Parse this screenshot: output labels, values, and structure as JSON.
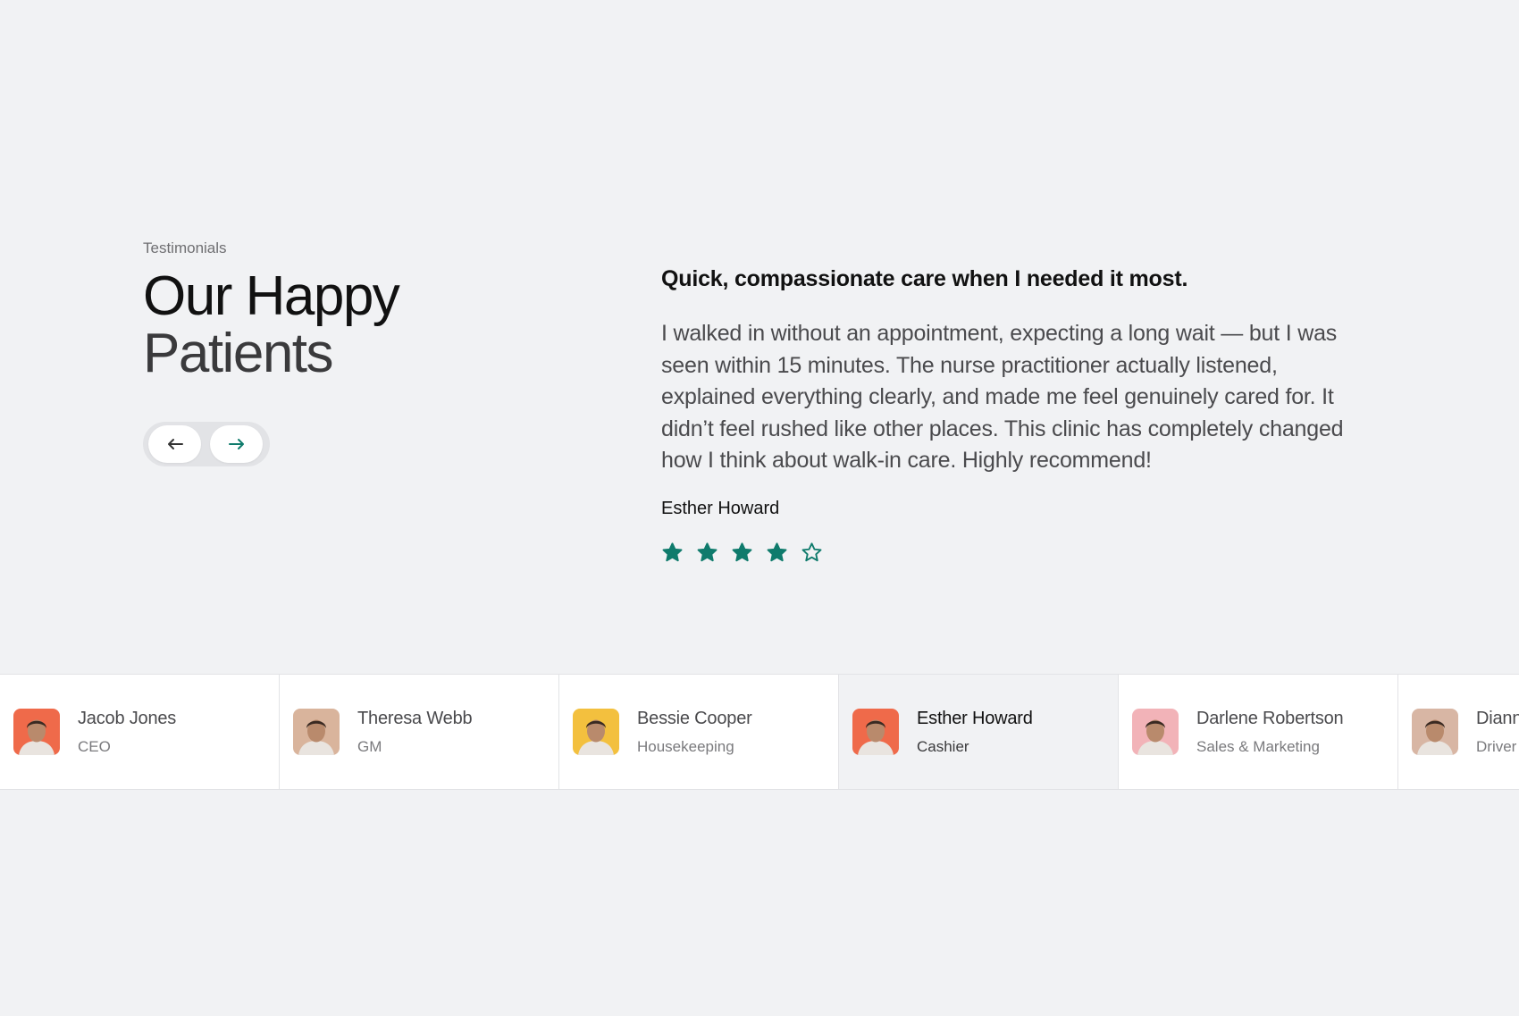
{
  "section": {
    "label": "Testimonials",
    "title_line1": "Our Happy",
    "title_line2": "Patients"
  },
  "nav": {
    "prev_icon": "arrow-left-icon",
    "next_icon": "arrow-right-icon"
  },
  "testimonial": {
    "headline": "Quick, compassionate care when I needed it most.",
    "body": "I walked in without an appointment, expecting a long wait — but I was seen within 15 minutes. The nurse practitioner actually listened, explained everything clearly, and made me feel genuinely cared for. It didn’t feel rushed like other places. This clinic has completely changed how I think about walk-in care. Highly recommend!",
    "author": "Esther Howard",
    "rating": 4,
    "rating_max": 5
  },
  "colors": {
    "accent": "#0f7b6c",
    "background": "#f1f2f4",
    "card_background": "#ffffff",
    "active_card_background": "#f1f2f4"
  },
  "team": [
    {
      "name": "Jacob Jones",
      "role": "CEO",
      "avatar_bg": "#ef6a4a",
      "active": false
    },
    {
      "name": "Theresa Webb",
      "role": "GM",
      "avatar_bg": "#d9b49c",
      "active": false
    },
    {
      "name": "Bessie Cooper",
      "role": "Housekeeping",
      "avatar_bg": "#f3c03e",
      "active": false
    },
    {
      "name": "Esther Howard",
      "role": "Cashier",
      "avatar_bg": "#ef6a4a",
      "active": true
    },
    {
      "name": "Darlene Robertson",
      "role": "Sales & Marketing",
      "avatar_bg": "#f2b3b8",
      "active": false
    },
    {
      "name": "Dianne Russell",
      "role": "Driver",
      "avatar_bg": "#d8b6a4",
      "active": false
    }
  ]
}
